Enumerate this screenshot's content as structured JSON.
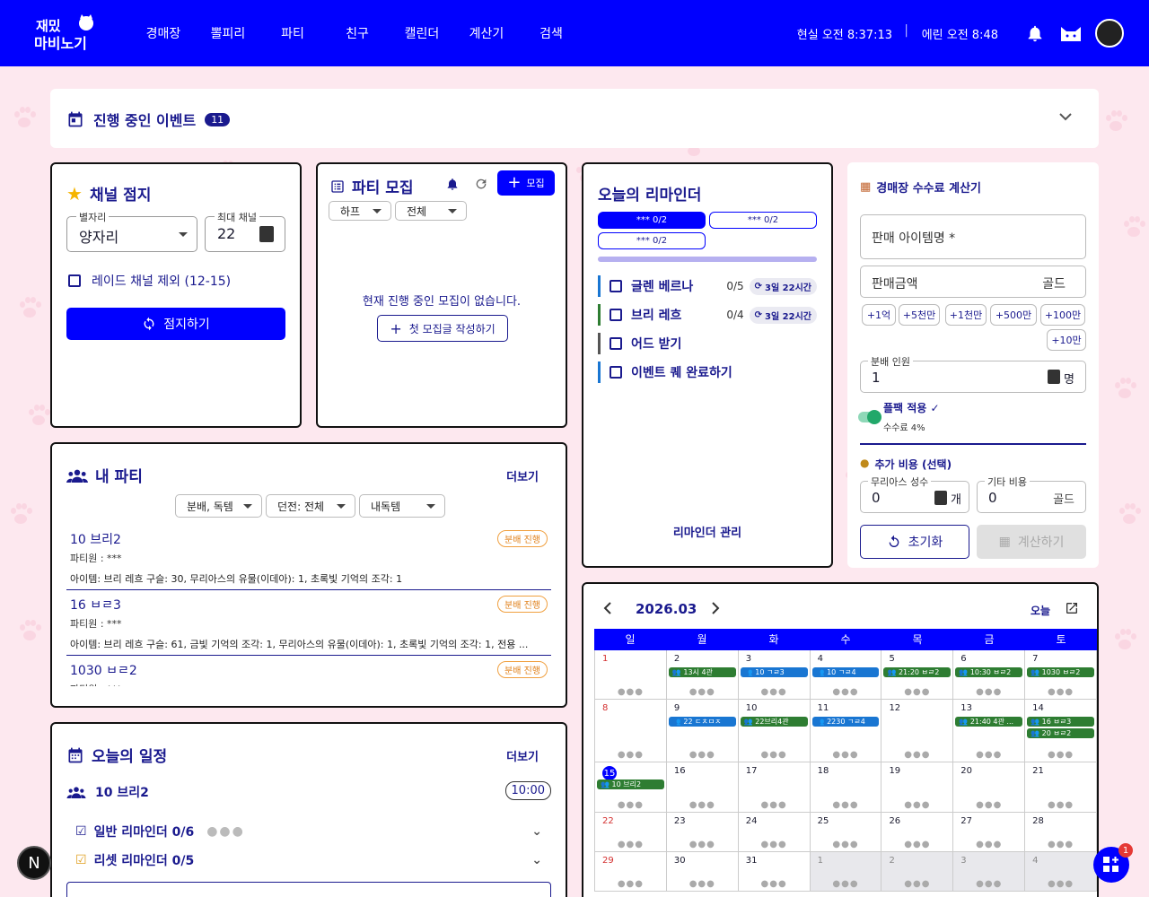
{
  "header": {
    "logo_text": "재밌는 마비노기",
    "nav": [
      "경매장",
      "뽈피리",
      "파티",
      "친구",
      "캘린더",
      "계산기",
      "검색"
    ],
    "real_time": "현실 오전 8:37:13",
    "erinn_time": "에린 오전 8:48"
  },
  "events": {
    "title": "진행 중인 이벤트",
    "count": "11"
  },
  "channel": {
    "title": "채널 점지",
    "constellation_label": "별자리",
    "constellation_value": "양자리",
    "max_label": "최대 채널",
    "max_value": "22",
    "raid_label": "레이드 채널 제외 (12-15)",
    "button": "점지하기"
  },
  "recruit": {
    "title": "파티 모집",
    "new_button": "모집",
    "filter1": "하프",
    "filter2": "전체",
    "empty": "현재 진행 중인 모집이 없습니다.",
    "create_button": "첫 모집글 작성하기"
  },
  "reminder": {
    "title": "오늘의 리마인더",
    "tabs": [
      "*** 0/2",
      "*** 0/2",
      "*** 0/2"
    ],
    "items": [
      {
        "label": "글렌 베르나",
        "count": "0/5",
        "timer": "3일 22시간",
        "color": "#1976d2"
      },
      {
        "label": "브리 레흐",
        "count": "0/4",
        "timer": "3일 22시간",
        "color": "#2e7d32"
      },
      {
        "label": "어드 받기",
        "count": "",
        "timer": "",
        "color": "#555555"
      },
      {
        "label": "이벤트 퀘 완료하기",
        "count": "",
        "timer": "",
        "color": "#1976d2"
      }
    ],
    "manage": "리마인더 관리"
  },
  "fee": {
    "title": "경매장 수수료 계산기",
    "item_label": "판매 아이템명 *",
    "price_label": "판매금액",
    "price_unit": "골드",
    "amounts": [
      "+1억",
      "+5천만",
      "+1천만",
      "+500만",
      "+100만",
      "+10만"
    ],
    "split_label": "분배 인원",
    "split_value": "1",
    "split_unit": "명",
    "flpack_label": "플팩 적용",
    "flpack_check": "✓",
    "fee_rate": "수수료 4%",
    "extra_title": "추가 비용 (선택)",
    "stone_label": "무리아스 성수",
    "stone_value": "0",
    "stone_unit": "개",
    "other_label": "기타 비용",
    "other_value": "0",
    "other_unit": "골드",
    "reset": "초기화",
    "calc": "계산하기"
  },
  "myparty": {
    "title": "내 파티",
    "more": "더보기",
    "filter1": "분배, 독템",
    "filter2": "던전: 전체",
    "filter3": "내독템",
    "parties": [
      {
        "name": "10 브리2",
        "status": "분배 진행",
        "leader": "파티원 : ***",
        "items": "아이템: 브리 레흐 구슬: 30, 무리아스의 유물(이데아): 1, 초록빛 기억의 조각: 1"
      },
      {
        "name": "16 ㅂㄹ3",
        "status": "분배 진행",
        "leader": "파티원 : ***",
        "items": "아이템: 브리 레흐 구슬: 61, 금빛 기억의 조각: 1, 무리아스의 유물(이데아): 1, 초록빛 기억의 조각: 1, 전용 ..."
      },
      {
        "name": "1030 ㅂㄹ2",
        "status": "분배 진행",
        "leader": "파티원 : ***",
        "items": ""
      }
    ]
  },
  "schedule": {
    "title": "오늘의 일정",
    "more": "더보기",
    "party": "10 브리2",
    "time": "10:00",
    "rows": [
      "일반 리마인더 0/6",
      "리셋 리마인더 0/5"
    ]
  },
  "calendar": {
    "month": "2026.03",
    "today_label": "오늘",
    "weekdays": [
      "일",
      "월",
      "화",
      "수",
      "목",
      "금",
      "토"
    ],
    "weeks": [
      [
        {
          "d": "1",
          "sun": true,
          "ev": []
        },
        {
          "d": "2",
          "ev": [
            {
              "t": "13시 4관",
              "c": "g"
            }
          ]
        },
        {
          "d": "3",
          "ev": [
            {
              "t": "10 ㄱㄹ3",
              "c": "b"
            }
          ]
        },
        {
          "d": "4",
          "ev": [
            {
              "t": "10 ㄱㄹ4",
              "c": "b"
            }
          ]
        },
        {
          "d": "5",
          "ev": [
            {
              "t": "21:20 ㅂㄹ2",
              "c": "g"
            }
          ]
        },
        {
          "d": "6",
          "ev": [
            {
              "t": "10:30 ㅂㄹ2",
              "c": "g"
            }
          ]
        },
        {
          "d": "7",
          "ev": [
            {
              "t": "1030 ㅂㄹ2",
              "c": "g"
            }
          ]
        }
      ],
      [
        {
          "d": "8",
          "sun": true,
          "ev": []
        },
        {
          "d": "9",
          "ev": [
            {
              "t": "22 ㄷㅊㅁㅈ",
              "c": "b"
            }
          ]
        },
        {
          "d": "10",
          "ev": [
            {
              "t": "22브리4관",
              "c": "g"
            }
          ]
        },
        {
          "d": "11",
          "ev": [
            {
              "t": "2230 ㄱㄹ4",
              "c": "b"
            }
          ]
        },
        {
          "d": "12",
          "ev": []
        },
        {
          "d": "13",
          "ev": [
            {
              "t": "21:40 4관 ...",
              "c": "g"
            }
          ]
        },
        {
          "d": "14",
          "ev": [
            {
              "t": "16 ㅂㄹ3",
              "c": "g"
            },
            {
              "t": "20 ㅂㄹ2",
              "c": "g"
            }
          ]
        }
      ],
      [
        {
          "d": "15",
          "today": true,
          "ev": [
            {
              "t": "10 브리2",
              "c": "g"
            }
          ]
        },
        {
          "d": "16",
          "ev": []
        },
        {
          "d": "17",
          "ev": []
        },
        {
          "d": "18",
          "ev": []
        },
        {
          "d": "19",
          "ev": []
        },
        {
          "d": "20",
          "ev": []
        },
        {
          "d": "21",
          "ev": []
        }
      ],
      [
        {
          "d": "22",
          "sun": true,
          "ev": []
        },
        {
          "d": "23",
          "ev": []
        },
        {
          "d": "24",
          "ev": []
        },
        {
          "d": "25",
          "ev": []
        },
        {
          "d": "26",
          "ev": []
        },
        {
          "d": "27",
          "ev": []
        },
        {
          "d": "28",
          "ev": []
        }
      ],
      [
        {
          "d": "29",
          "sun": true,
          "ev": []
        },
        {
          "d": "30",
          "ev": []
        },
        {
          "d": "31",
          "ev": []
        },
        {
          "d": "1",
          "out": true,
          "ev": []
        },
        {
          "d": "2",
          "out": true,
          "ev": []
        },
        {
          "d": "3",
          "out": true,
          "ev": []
        },
        {
          "d": "4",
          "out": true,
          "ev": []
        }
      ]
    ]
  },
  "fab": {
    "badge": "1",
    "n_label": "N"
  }
}
